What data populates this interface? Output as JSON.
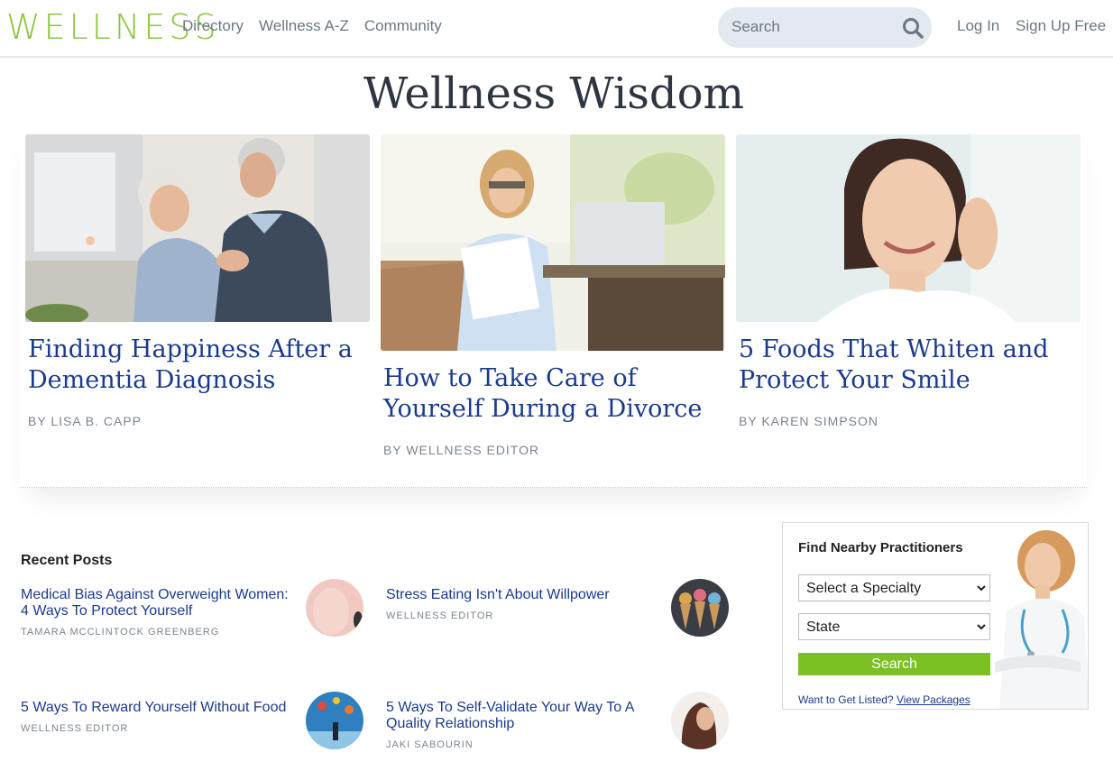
{
  "header": {
    "logo": "WELLNESS",
    "nav": [
      "Directory",
      "Wellness A-Z",
      "Community"
    ],
    "search_placeholder": "Search",
    "login": "Log In",
    "signup": "Sign Up Free"
  },
  "page_title": "Wellness Wisdom",
  "featured": [
    {
      "title": "Finding Happiness After a Dementia Diagnosis",
      "byline": "BY LISA B. CAPP"
    },
    {
      "title": "How to Take Care of Yourself During a Divorce",
      "byline": "BY WELLNESS EDITOR"
    },
    {
      "title": "5 Foods That Whiten and Protect Your Smile",
      "byline": "BY KAREN SIMPSON"
    }
  ],
  "recent": {
    "heading": "Recent Posts",
    "posts": [
      {
        "title": "Medical Bias Against Overweight Women: 4 Ways To Protect Yourself",
        "author": "TAMARA MCCLINTOCK GREENBERG"
      },
      {
        "title": "Stress Eating Isn't About Willpower",
        "author": "WELLNESS EDITOR"
      },
      {
        "title": "5 Ways To Reward Yourself Without Food",
        "author": "WELLNESS EDITOR"
      },
      {
        "title": "5 Ways To Self-Validate Your Way To A Quality Relationship",
        "author": "JAKI SABOURIN"
      }
    ]
  },
  "widget": {
    "heading": "Find Nearby Practitioners",
    "specialty_value": "Select a Specialty",
    "state_value": "State",
    "search_button": "Search",
    "listed_text": "Want to Get Listed?",
    "listed_link": "View Packages"
  },
  "colors": {
    "brand_green": "#8cc63f",
    "button_green": "#7ac121",
    "link_blue": "#1a3a8f"
  }
}
